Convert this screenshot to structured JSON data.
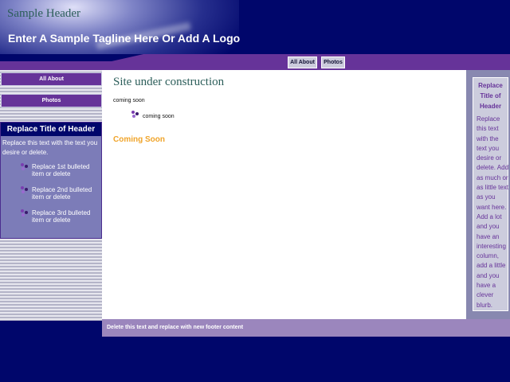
{
  "header": {
    "site_title": "Sample Header",
    "tagline": "Enter A Sample Tagline Here Or Add A Logo"
  },
  "top_nav": [
    "All About",
    "Photos"
  ],
  "side_nav": [
    "All About",
    "Photos"
  ],
  "sidebar_box": {
    "title": "Replace Title of Header",
    "text": "Replace this text with the text you desire or delete.",
    "bullets": [
      "Replace 1st bulleted item or delete",
      "Replace 2nd bulleted item or delete",
      "Replace 3rd bulleted item or delete"
    ]
  },
  "main": {
    "heading": "Site under construction",
    "paragraph": "coming soon",
    "bullet": "coming soon",
    "subheading": "Coming Soon"
  },
  "right_box": {
    "title": "Replace Title of Header",
    "text": "Replace this text with the text you desire or delete. Add as much or as little text as you want here. Add a lot and you have an interesting column, add a little and you have a clever blurb."
  },
  "footer": {
    "text": "Delete this text and replace with new footer content"
  },
  "colors": {
    "background": "#00066b",
    "nav_purple": "#663399",
    "accent_orange": "#f0a42a",
    "heading_teal": "#2c5e5a",
    "footer": "#9b86bd"
  },
  "icons": {
    "bullet": "purple-dots-bullet-icon"
  }
}
